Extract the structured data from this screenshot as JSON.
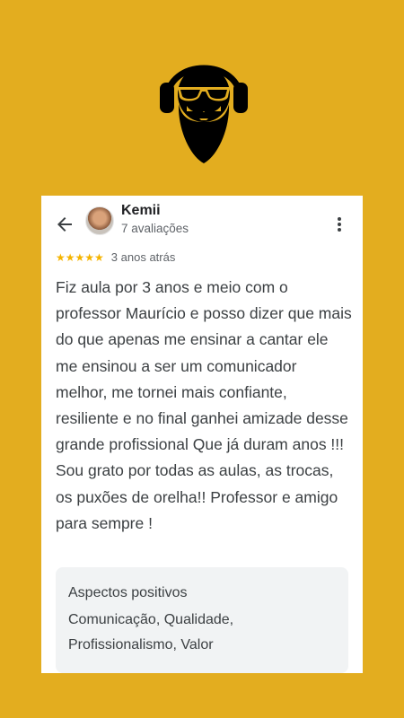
{
  "colors": {
    "background": "#E3AD1F",
    "card": "#FFFFFF",
    "star": "#F5B400",
    "panel": "#F1F3F4"
  },
  "logo": {
    "icon": "bearded-man-headphones-icon"
  },
  "review": {
    "back_icon": "arrow-left-icon",
    "more_icon": "more-vert-icon",
    "reviewer_name": "Kemii",
    "reviewer_count": "7 avaliações",
    "rating": 5,
    "stars": "★★★★★",
    "time": "3 anos atrás",
    "text": "Fiz aula por 3 anos e meio com o professor Maurício e posso dizer que mais do que apenas me ensinar a cantar ele me ensinou a ser um comunicador melhor, me tornei mais confiante, resiliente e no final ganhei amizade desse grande profissional Que já duram anos !!! Sou grato por todas as aulas, as trocas, os puxões de orelha!! Professor e amigo para sempre !",
    "aspects_title": "Aspectos positivos",
    "aspects": "Comunicação, Qualidade, Profissionalismo, Valor"
  }
}
